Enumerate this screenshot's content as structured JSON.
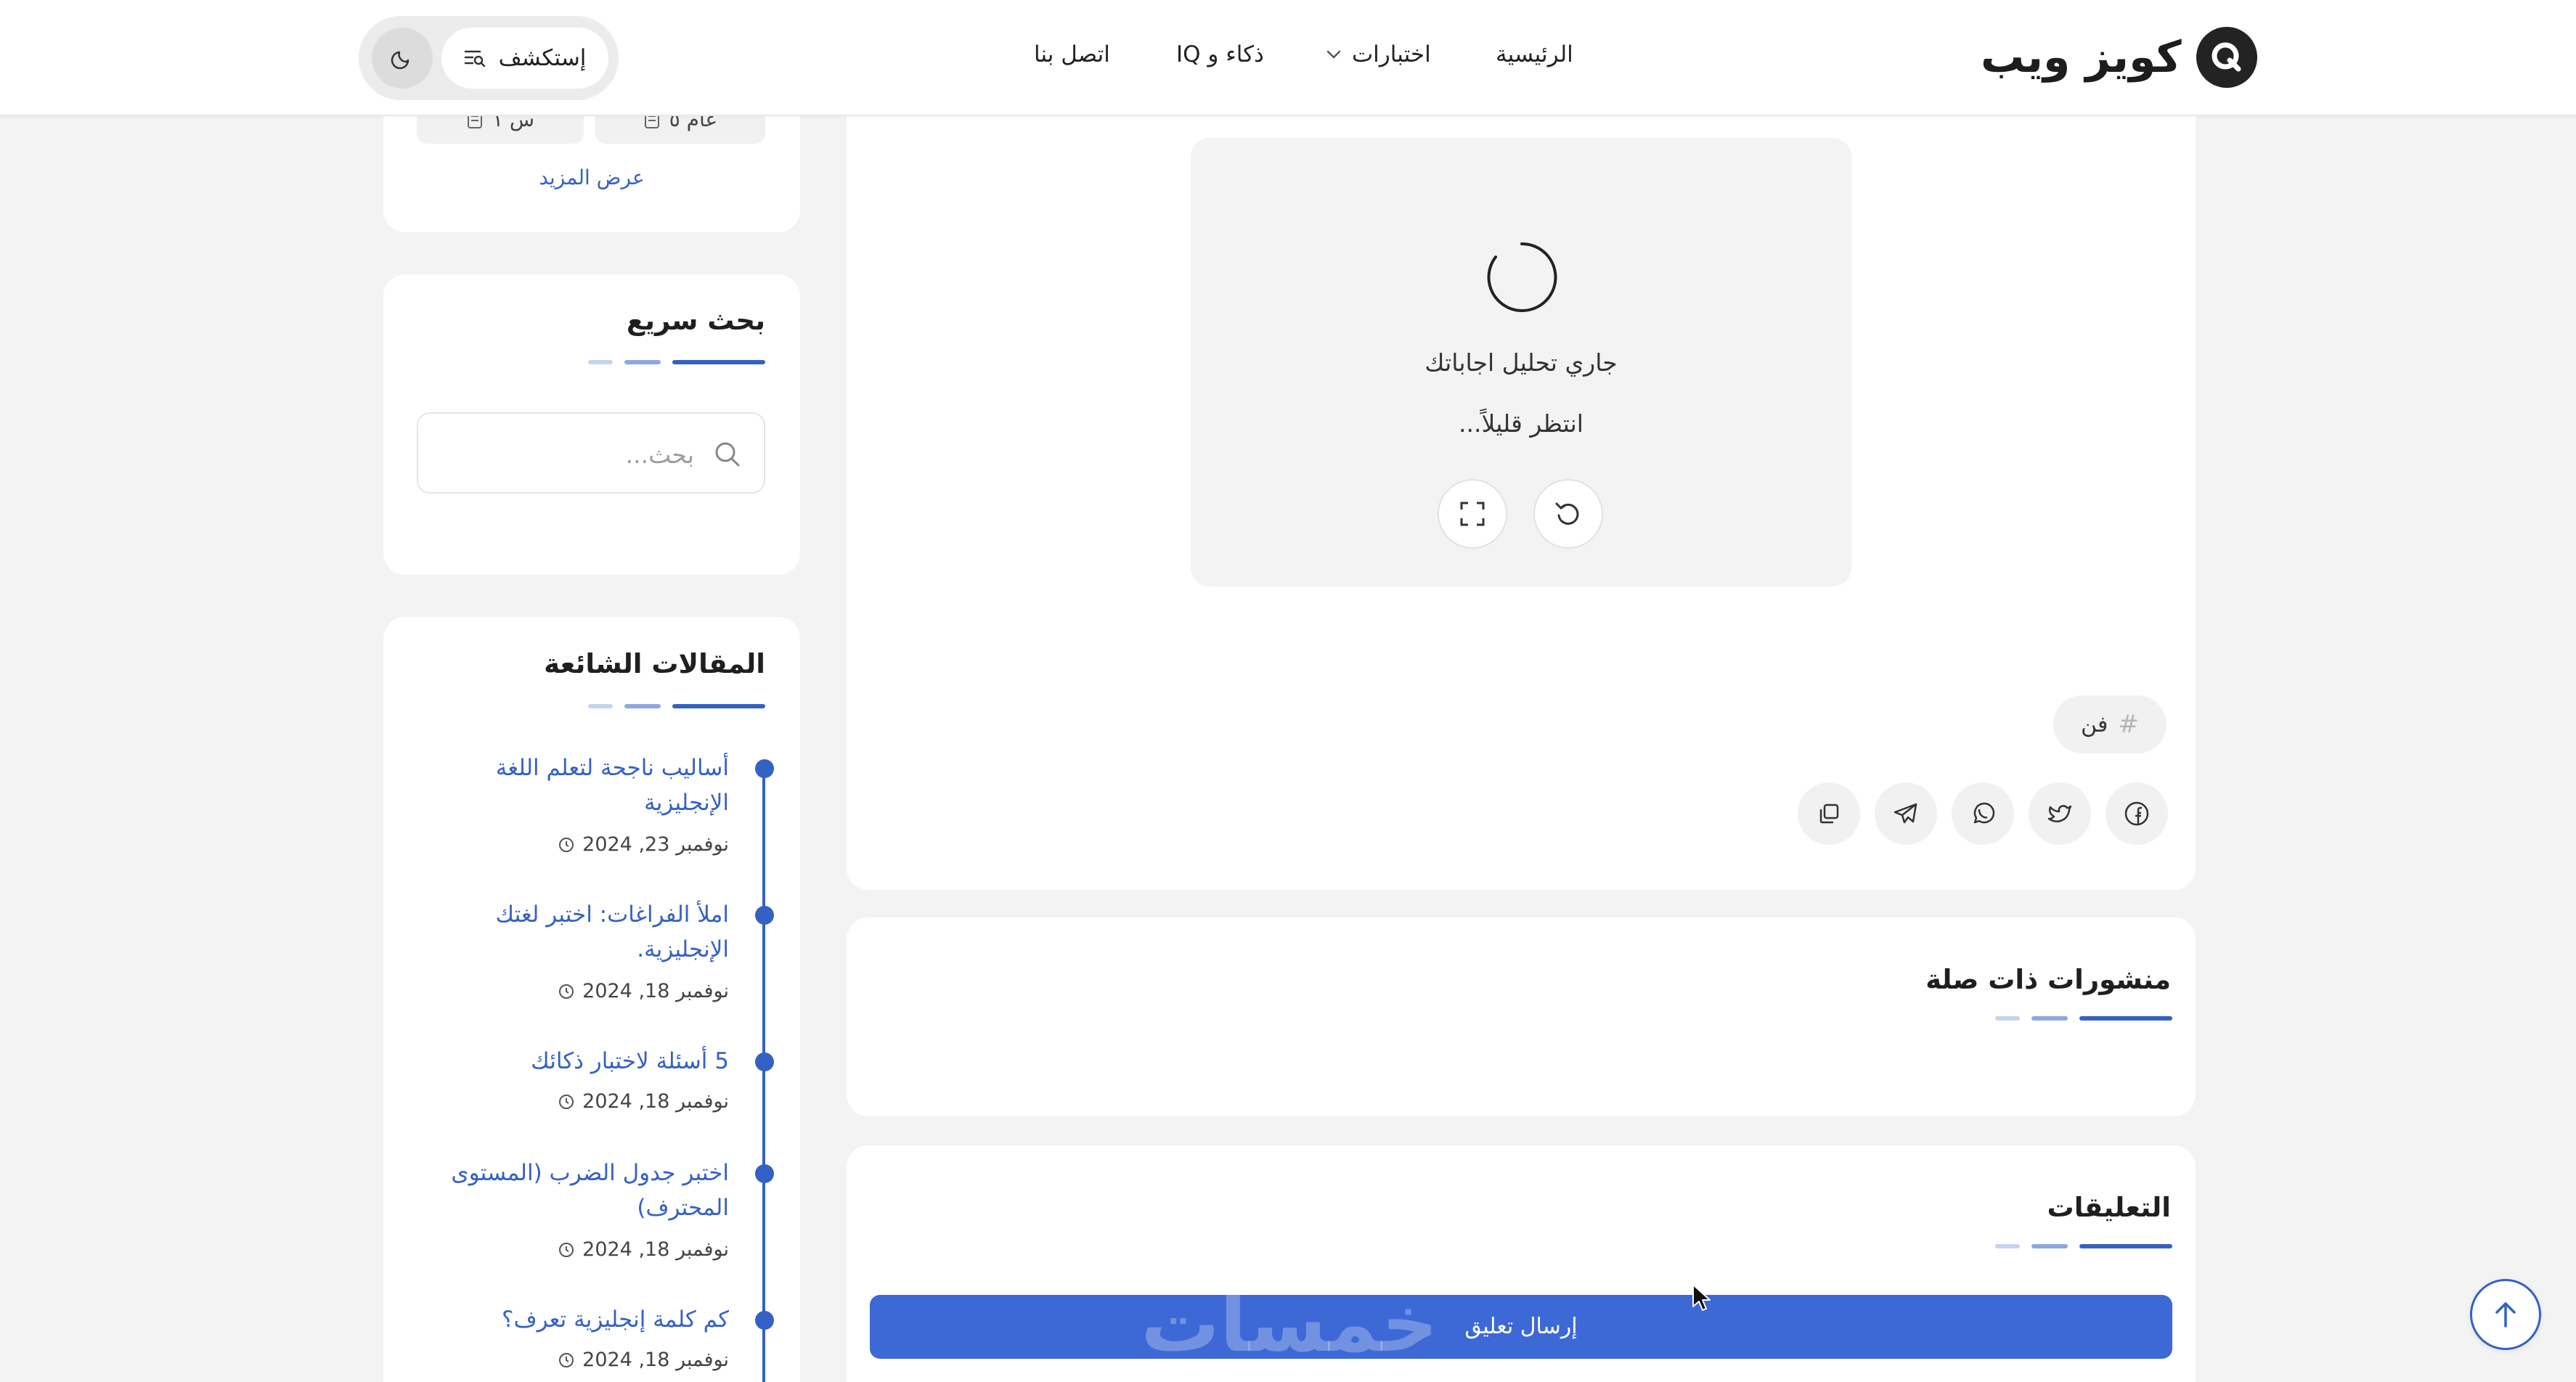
{
  "header": {
    "logo_text": "كويز ويب",
    "logo_mark": "Q",
    "nav": {
      "home": "الرئيسية",
      "tests": "اختبارات",
      "iq": "ذكاء و IQ",
      "contact": "اتصل بنا"
    },
    "explore_label": "إستكشف"
  },
  "sidebar": {
    "top_card": {
      "chips": [
        "عام ٥",
        "س ١"
      ],
      "show_more": "عرض المزيد"
    },
    "quick_search": {
      "title": "بحث سريع",
      "placeholder": "بحث..."
    },
    "popular": {
      "title": "المقالات الشائعة",
      "articles": [
        {
          "title": "أساليب ناجحة لتعلم اللغة الإنجليزية",
          "date": "نوفمبر 23, 2024"
        },
        {
          "title": "املأ الفراغات: اختبر لغتك الإنجليزية.",
          "date": "نوفمبر 18, 2024"
        },
        {
          "title": "5 أسئلة لاختبار ذكائك",
          "date": "نوفمبر 18, 2024"
        },
        {
          "title": "اختبر جدول الضرب (المستوى المحترف)",
          "date": "نوفمبر 18, 2024"
        },
        {
          "title": "كم كلمة إنجليزية تعرف؟",
          "date": "نوفمبر 18, 2024"
        }
      ]
    }
  },
  "main": {
    "quiz": {
      "analyzing_text": "جاري تحليل اجاباتك",
      "waiting_text": "انتظر قليلاً..."
    },
    "tag": {
      "hash": "#",
      "label": "فن"
    },
    "related": {
      "title": "منشورات ذات صلة"
    },
    "comments": {
      "title": "التعليقات",
      "submit_label": "إرسال تعليق"
    },
    "watermark": "خمسات"
  },
  "colors": {
    "accent": "#3461c4",
    "button": "#3c69d6",
    "background": "#f3f3f3",
    "card": "#ffffff"
  },
  "icons": {
    "share": [
      "facebook-icon",
      "twitter-icon",
      "whatsapp-icon",
      "telegram-icon",
      "copy-icon"
    ],
    "quiz_controls": [
      "refresh-icon",
      "fullscreen-icon"
    ],
    "header": [
      "explore-filter-icon",
      "moon-icon"
    ],
    "misc": [
      "search-icon",
      "clock-icon",
      "arrow-up-icon",
      "document-icon"
    ]
  }
}
